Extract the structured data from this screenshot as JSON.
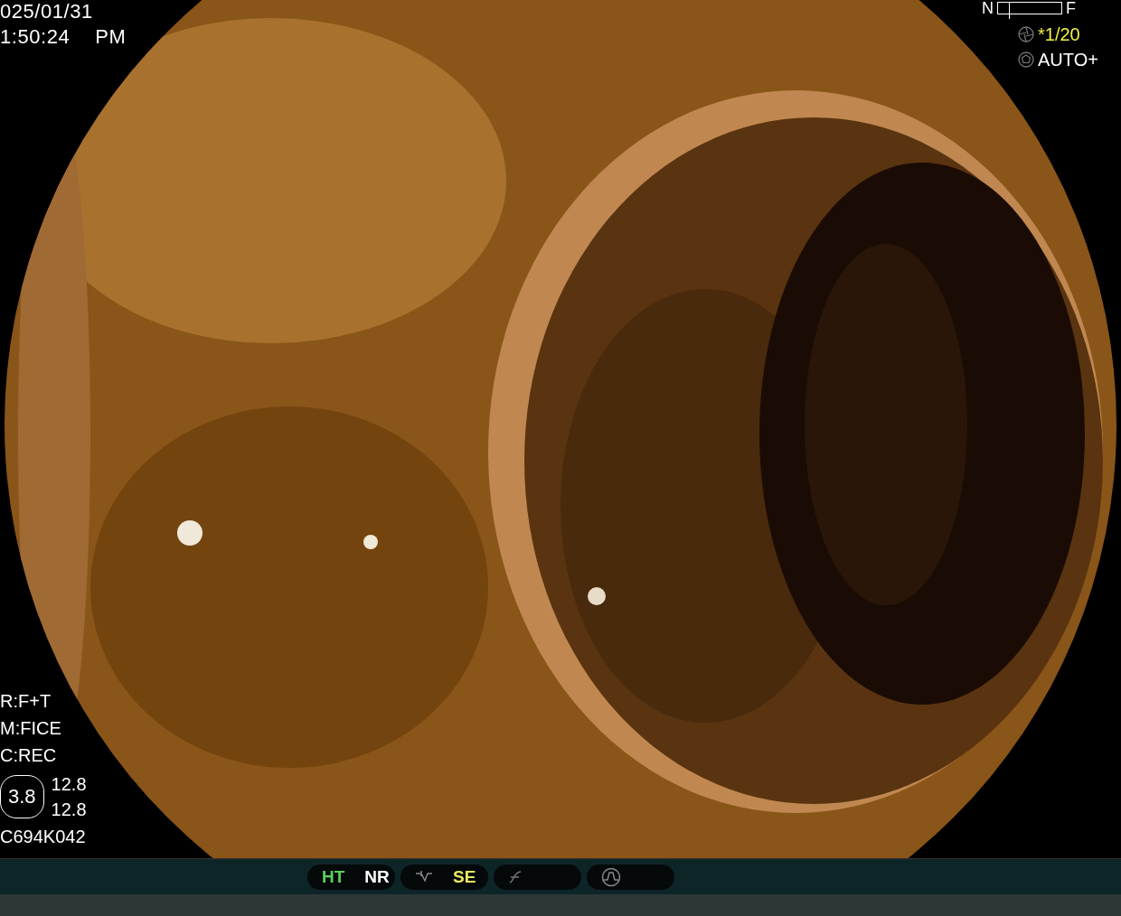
{
  "datetime": {
    "date": "025/01/31",
    "time": "1:50:24",
    "ampm": "PM"
  },
  "focus": {
    "near": "N",
    "far": "F",
    "level": 0.17
  },
  "exposure": [
    {
      "kind": "shutter",
      "text": "*1/20"
    },
    {
      "kind": "aperture",
      "text": "AUTO+"
    }
  ],
  "left_info": [
    "R:F+T",
    "M:FICE",
    "C:REC"
  ],
  "zoom": {
    "value": "3.8",
    "readings": [
      "12.8",
      "12.8"
    ]
  },
  "serial": "C694K042",
  "toolbar": [
    {
      "items": [
        {
          "kind": "text",
          "label": "HT",
          "color": "#5ad05a"
        },
        {
          "kind": "text",
          "label": "NR",
          "color": "#ffffff"
        }
      ]
    },
    {
      "items": [
        {
          "kind": "tone"
        },
        {
          "kind": "text",
          "label": "SE",
          "color": "#e8e860"
        }
      ]
    },
    {
      "items": [
        {
          "kind": "curve"
        }
      ]
    },
    {
      "items": [
        {
          "kind": "wave"
        }
      ]
    }
  ]
}
